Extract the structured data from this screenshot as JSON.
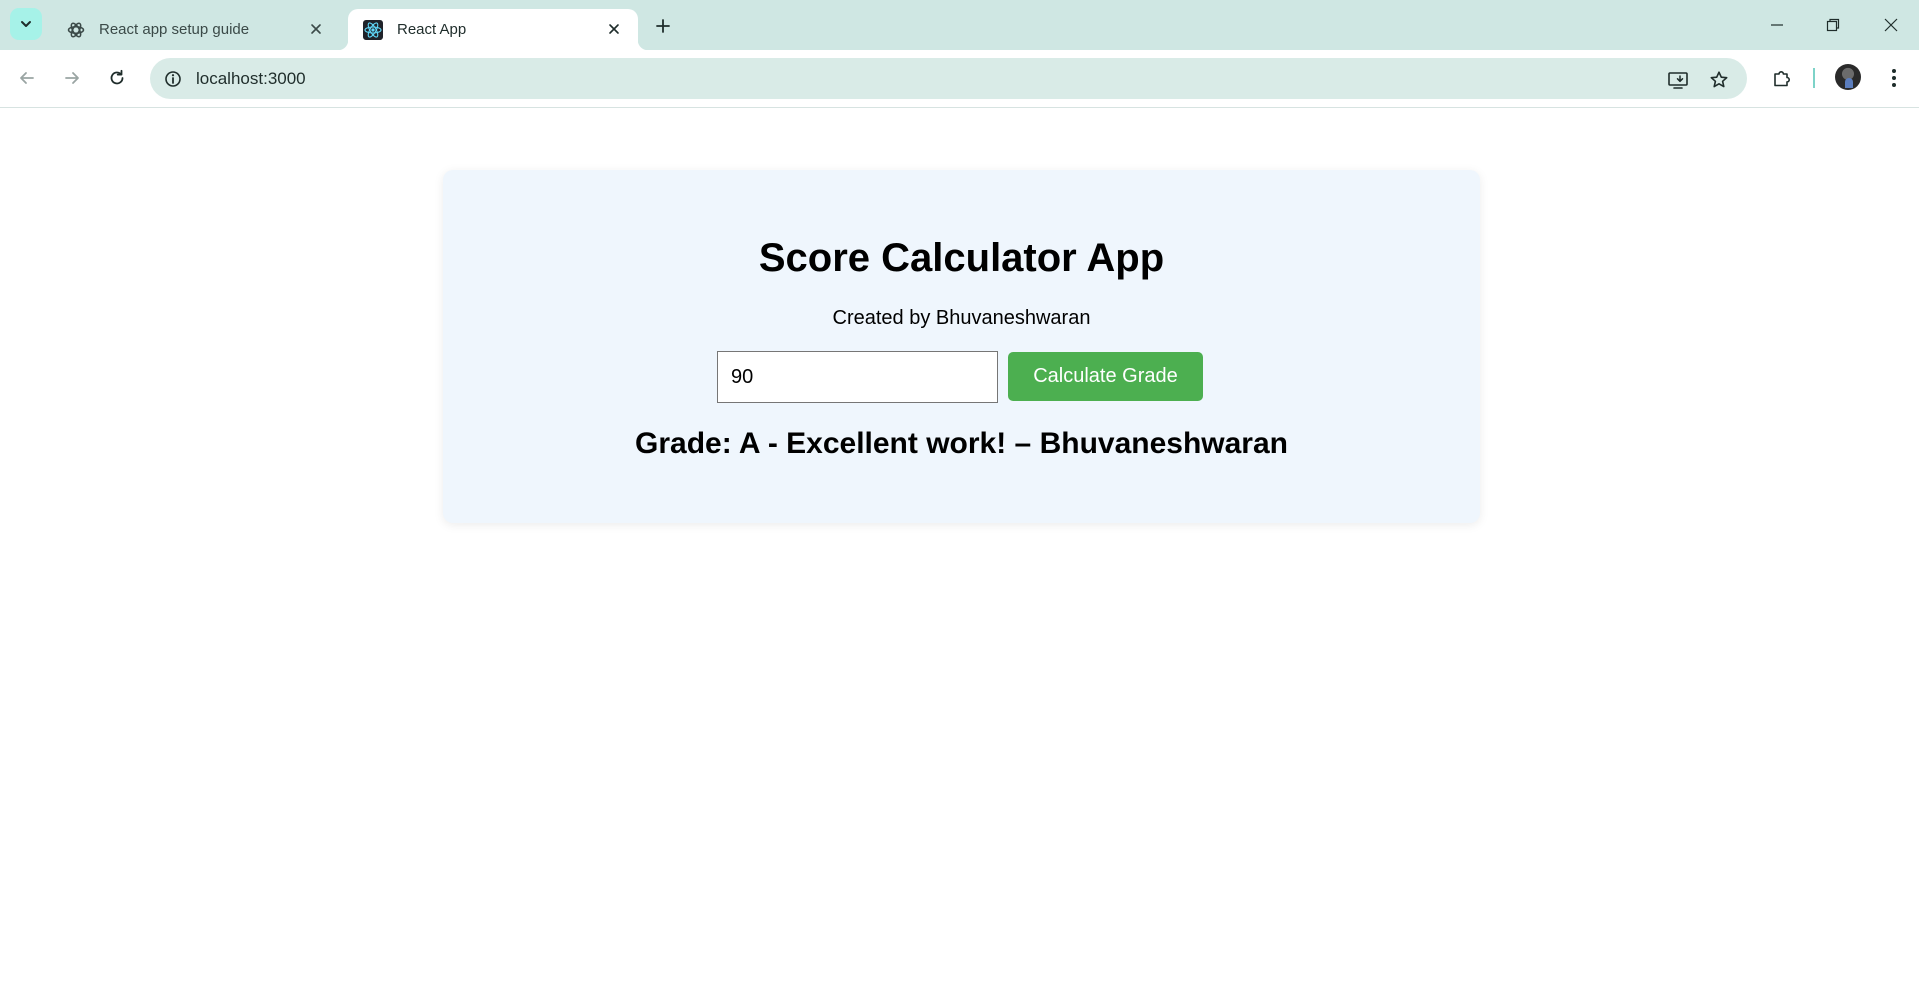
{
  "browser": {
    "tabs": [
      {
        "title": "React app setup guide",
        "icon": "openai-icon",
        "active": false
      },
      {
        "title": "React App",
        "icon": "react-icon",
        "active": true
      }
    ],
    "address": {
      "url": "localhost:3000"
    },
    "icons": {
      "tab_search": "chevron-down-icon",
      "new_tab": "plus-icon",
      "minimize": "minimize-icon",
      "restore": "restore-icon",
      "close": "close-icon",
      "back": "arrow-left-icon",
      "forward": "arrow-right-icon",
      "reload": "reload-icon",
      "site_info": "info-icon",
      "install": "install-app-icon",
      "bookmark": "star-icon",
      "extensions": "puzzle-icon",
      "menu": "kebab-menu-icon"
    },
    "colors": {
      "tabstrip": "#cfe7e3",
      "omnibox": "#d9ebe7",
      "tab_search_bg": "#a6f2e8"
    }
  },
  "app": {
    "title": "Score Calculator App",
    "subtitle": "Created by Bhuvaneshwaran",
    "score_input": {
      "value": "90",
      "placeholder": ""
    },
    "calculate_button": "Calculate Grade",
    "result": "Grade: A - Excellent work! – Bhuvaneshwaran",
    "colors": {
      "card_bg": "#eff6fd",
      "button_bg": "#4caf50",
      "button_text": "#ffffff"
    }
  }
}
